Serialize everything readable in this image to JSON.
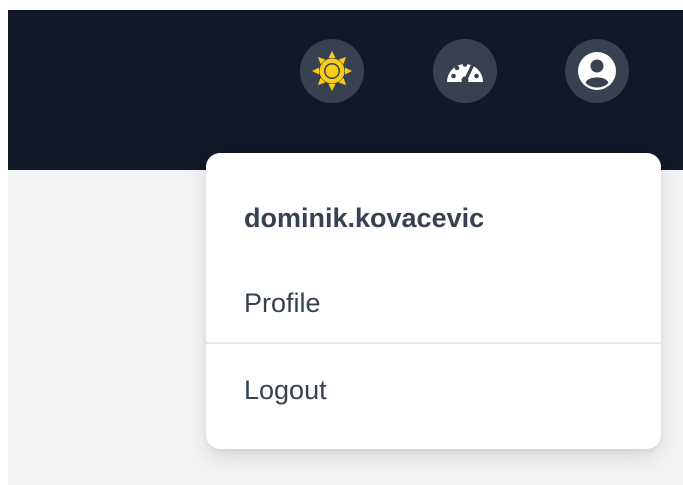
{
  "header": {
    "background": "#111827",
    "buttons": [
      {
        "icon": "sun-icon",
        "color": "#facc15"
      },
      {
        "icon": "speedometer-icon",
        "color": "#ffffff"
      },
      {
        "icon": "user-circle-icon",
        "color": "#ffffff"
      }
    ]
  },
  "user_menu": {
    "username": "dominik.kovacevic",
    "items": {
      "profile": "Profile",
      "logout": "Logout"
    }
  }
}
